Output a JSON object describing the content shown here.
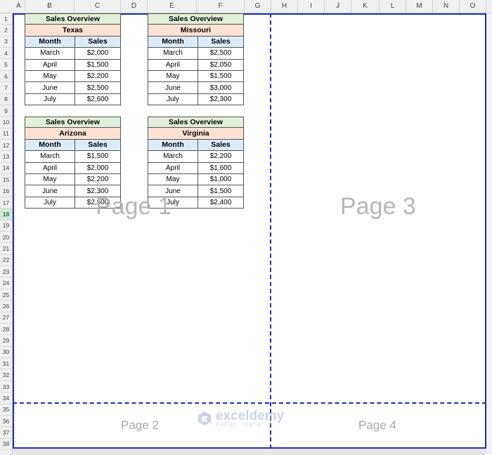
{
  "columns": [
    "A",
    "B",
    "C",
    "D",
    "E",
    "F",
    "G",
    "H",
    "I",
    "J",
    "K",
    "L",
    "M",
    "N",
    "O"
  ],
  "rows": [
    "1",
    "2",
    "3",
    "4",
    "5",
    "6",
    "7",
    "8",
    "9",
    "10",
    "11",
    "12",
    "13",
    "14",
    "15",
    "16",
    "17",
    "18",
    "19",
    "20",
    "21",
    "22",
    "23",
    "24",
    "25",
    "26",
    "27",
    "28",
    "29",
    "30",
    "31",
    "32",
    "33",
    "34",
    "35",
    "36",
    "37",
    "38"
  ],
  "active_row": "18",
  "pages": {
    "page1": "Page 1",
    "page2": "Page 2",
    "page3": "Page 3",
    "page4": "Page 4"
  },
  "page_border_color": "#1d2fb0",
  "tables": [
    {
      "overview": "Sales Overview",
      "state": "Texas",
      "headers": [
        "Month",
        "Sales"
      ],
      "data": [
        [
          "March",
          "$2,000"
        ],
        [
          "April",
          "$1,500"
        ],
        [
          "May",
          "$2,200"
        ],
        [
          "June",
          "$2,500"
        ],
        [
          "July",
          "$2,600"
        ]
      ]
    },
    {
      "overview": "Sales Overview",
      "state": "Missouri",
      "headers": [
        "Month",
        "Sales"
      ],
      "data": [
        [
          "March",
          "$2,500"
        ],
        [
          "April",
          "$2,050"
        ],
        [
          "May",
          "$1,500"
        ],
        [
          "June",
          "$3,000"
        ],
        [
          "July",
          "$2,300"
        ]
      ]
    },
    {
      "overview": "Sales Overview",
      "state": "Arizona",
      "headers": [
        "Month",
        "Sales"
      ],
      "data": [
        [
          "March",
          "$1,500"
        ],
        [
          "April",
          "$2,000"
        ],
        [
          "May",
          "$2,200"
        ],
        [
          "June",
          "$2,300"
        ],
        [
          "July",
          "$2,500"
        ]
      ]
    },
    {
      "overview": "Sales Overview",
      "state": "Virginia",
      "headers": [
        "Month",
        "Sales"
      ],
      "data": [
        [
          "March",
          "$2,200"
        ],
        [
          "April",
          "$1,600"
        ],
        [
          "May",
          "$1,000"
        ],
        [
          "June",
          "$1,500"
        ],
        [
          "July",
          "$2,400"
        ]
      ]
    }
  ],
  "watermark": {
    "name": "exceldemy",
    "tagline": "EXCEL · DATA · BI"
  }
}
